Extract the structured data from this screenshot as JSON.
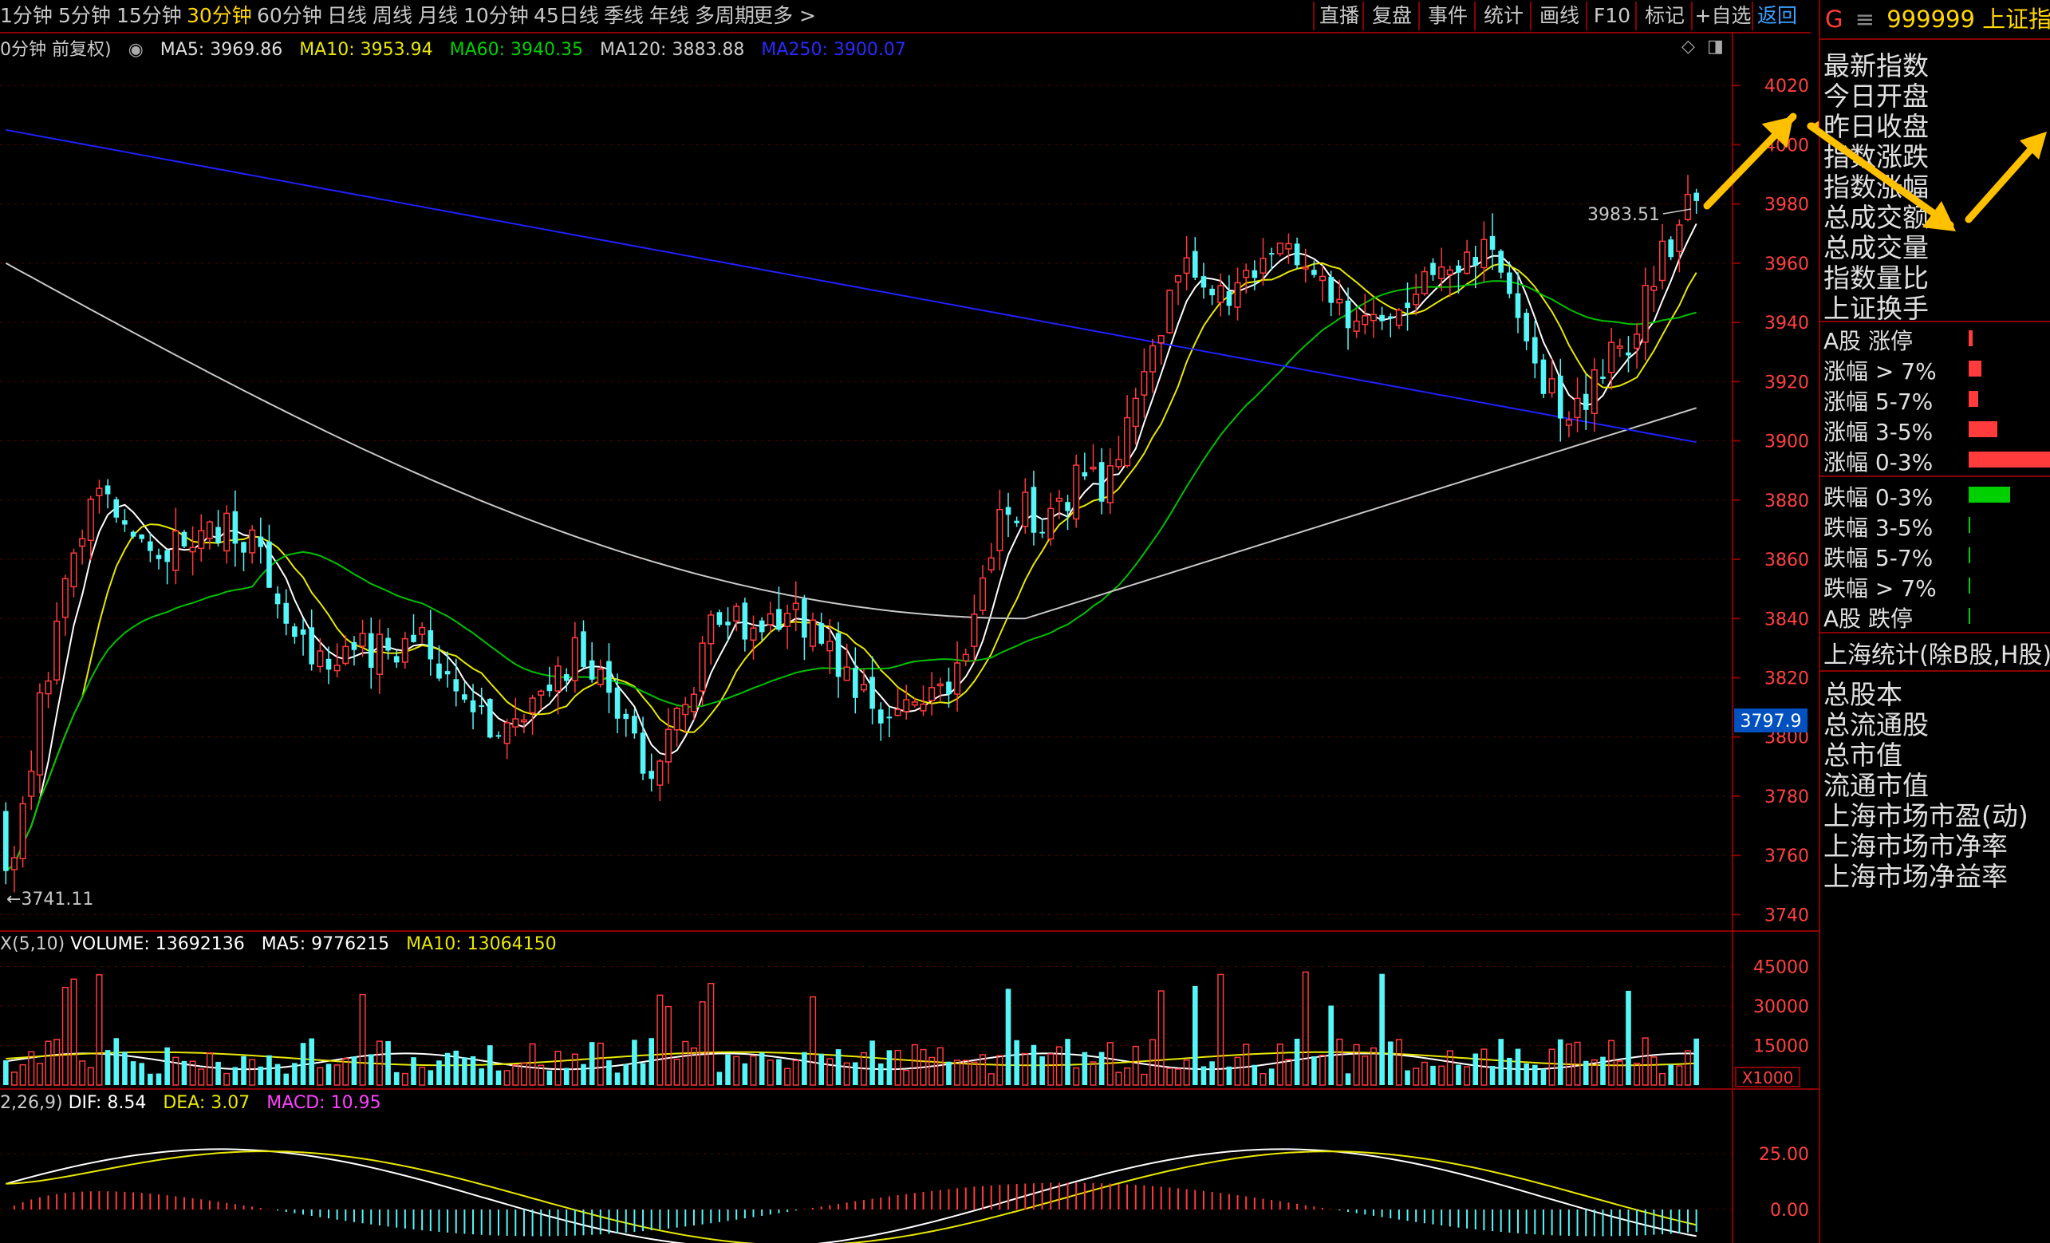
{
  "toolbar": {
    "periods": [
      "1分钟",
      "5分钟",
      "15分钟",
      "30分钟",
      "60分钟",
      "日线",
      "周线",
      "月线",
      "10分钟",
      "45日线",
      "季线",
      "年线",
      "多周期",
      "更多 >"
    ],
    "active_period": "30分钟",
    "right_buttons": [
      "直播",
      "复盘",
      "事件",
      "统计",
      "画线",
      "F10",
      "标记",
      "+自选",
      "返回"
    ]
  },
  "main_legend": {
    "title": "0分钟 前复权)",
    "ma5": "MA5: 3969.86",
    "ma10": "MA10: 3953.94",
    "ma60": "MA60: 3940.35",
    "ma120": "MA120: 3883.88",
    "ma250": "MA250: 3900.07"
  },
  "vol_legend": {
    "label": "X(5,10)",
    "volume": "VOLUME: 13692136",
    "ma5": "MA5: 9776215",
    "ma10": "MA10: 13064150"
  },
  "macd_legend": {
    "label": "2,26,9)",
    "dif": "DIF: 8.54",
    "dea": "DEA: 3.07",
    "macd": "MACD: 10.95"
  },
  "price_axis": {
    "ticks": [
      "4020",
      "4000",
      "3980",
      "3960",
      "3940",
      "3920",
      "3900",
      "3880",
      "3860",
      "3840",
      "3820",
      "3800",
      "3780",
      "3760",
      "3740"
    ],
    "current_marker": "3797.9"
  },
  "volume_axis": {
    "ticks": [
      "45000",
      "30000",
      "15000"
    ],
    "unit": "X1000"
  },
  "macd_axis": {
    "ticks": [
      "25.00",
      "0.00"
    ]
  },
  "annotations": {
    "high": "3983.51",
    "low": "←3741.11"
  },
  "sidebar": {
    "code": "999999",
    "name": "上证指数",
    "g_label": "G",
    "menu_glyph": "≡",
    "fields": [
      "最新指数",
      "今日开盘",
      "昨日收盘",
      "指数涨跌",
      "指数涨幅",
      "总成交额",
      "总成交量",
      "指数量比",
      "上证换手"
    ],
    "distribution": [
      {
        "label": "A股 涨停",
        "frac": 0.05,
        "color": "#ff3b3b"
      },
      {
        "label": "涨幅 > 7%",
        "frac": 0.15,
        "color": "#ff3b3b"
      },
      {
        "label": "涨幅 5-7%",
        "frac": 0.12,
        "color": "#ff3b3b"
      },
      {
        "label": "涨幅 3-5%",
        "frac": 0.35,
        "color": "#ff3b3b"
      },
      {
        "label": "涨幅 0-3%",
        "frac": 1.0,
        "color": "#ff3b3b"
      },
      {
        "label": "跌幅 0-3%",
        "frac": 0.5,
        "color": "#00d000"
      },
      {
        "label": "跌幅 3-5%",
        "frac": 0.02,
        "color": "#00d000"
      },
      {
        "label": "跌幅 5-7%",
        "frac": 0.02,
        "color": "#00d000"
      },
      {
        "label": "跌幅 > 7%",
        "frac": 0.02,
        "color": "#00d000"
      },
      {
        "label": "A股 跌停",
        "frac": 0.02,
        "color": "#00d000"
      }
    ],
    "stats_header": "上海统计(除B股,H股)",
    "stats_fields": [
      "总股本",
      "总流通股",
      "总市值",
      "流通市值",
      "上海市场市盈(动)",
      "上海市场市净率",
      "上海市场净益率"
    ]
  },
  "colors": {
    "up": "#ff3b3b",
    "down": "#54f6f8",
    "ma5": "#ffffff",
    "ma10": "#e8e800",
    "ma60": "#00c000",
    "ma120": "#c8c8c8",
    "ma250": "#2020ff",
    "frame": "#8b0000",
    "arrow": "#ffc000",
    "macd_up": "#ff3b3b",
    "macd_down": "#54f6f8"
  },
  "chart_data": {
    "type": "candlestick",
    "price_range": [
      3735,
      4030
    ],
    "close_path": [
      3750,
      3790,
      3830,
      3870,
      3880,
      3872,
      3860,
      3865,
      3870,
      3868,
      3872,
      3865,
      3850,
      3830,
      3825,
      3832,
      3830,
      3828,
      3840,
      3825,
      3812,
      3805,
      3800,
      3815,
      3820,
      3830,
      3820,
      3805,
      3790,
      3800,
      3815,
      3845,
      3840,
      3832,
      3845,
      3840,
      3830,
      3815,
      3808,
      3805,
      3810,
      3818,
      3830,
      3860,
      3880,
      3875,
      3875,
      3890,
      3885,
      3905,
      3930,
      3945,
      3960,
      3955,
      3950,
      3958,
      3962,
      3955,
      3945,
      3940,
      3942,
      3945,
      3950,
      3962,
      3965,
      3960,
      3945,
      3925,
      3910,
      3912,
      3925,
      3935,
      3955,
      3970,
      3983
    ],
    "volume_range": [
      0,
      50000
    ],
    "macd_range": [
      -15,
      45
    ]
  }
}
